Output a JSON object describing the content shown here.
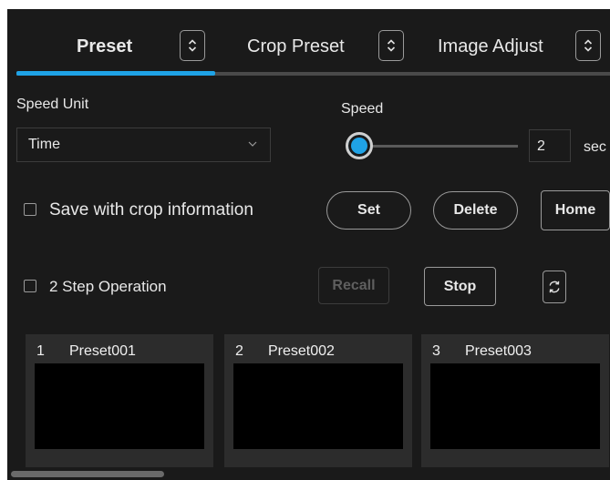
{
  "tabs": [
    {
      "label": "Preset",
      "active": true
    },
    {
      "label": "Crop Preset",
      "active": false
    },
    {
      "label": "Image Adjust",
      "active": false
    }
  ],
  "speed_unit": {
    "label": "Speed Unit",
    "value": "Time"
  },
  "speed": {
    "label": "Speed",
    "value": "2",
    "unit": "sec",
    "slider_fraction": 0.0
  },
  "save_crop": {
    "label": "Save with crop information",
    "checked": false
  },
  "buttons": {
    "set": "Set",
    "delete": "Delete",
    "home": "Home",
    "recall": "Recall",
    "stop": "Stop"
  },
  "two_step": {
    "label": "2 Step Operation",
    "checked": false
  },
  "presets": [
    {
      "number": "1",
      "name": "Preset001"
    },
    {
      "number": "2",
      "name": "Preset002"
    },
    {
      "number": "3",
      "name": "Preset003"
    }
  ],
  "colors": {
    "accent": "#1fa3e6",
    "background": "#1a1a1a",
    "card": "#2c2c2c"
  },
  "icons": {
    "tab_toggle": "chevron-up-down-icon",
    "select": "chevron-down-icon",
    "refresh": "refresh-icon"
  }
}
